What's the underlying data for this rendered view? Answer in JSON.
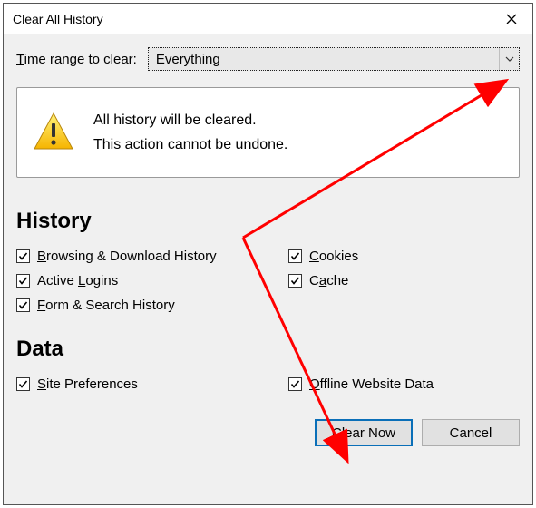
{
  "titlebar": {
    "title": "Clear All History"
  },
  "range": {
    "label_pre": "T",
    "label_ul": "",
    "label": "Time range to clear:",
    "selected": "Everything"
  },
  "warning": {
    "line1": "All history will be cleared.",
    "line2": "This action cannot be undone."
  },
  "sections": {
    "history": "History",
    "data": "Data"
  },
  "checks": {
    "browsing": {
      "label": "Browsing & Download History",
      "ul": "B",
      "checked": true
    },
    "cookies": {
      "label": "Cookies",
      "ul": "C",
      "checked": true
    },
    "logins": {
      "label": "Active Logins",
      "ul": "L",
      "checked": true
    },
    "cache": {
      "label": "Cache",
      "ul": "a",
      "checked": true
    },
    "form": {
      "label": "Form & Search History",
      "ul": "F",
      "checked": true
    },
    "siteprefs": {
      "label": "Site Preferences",
      "ul": "S",
      "checked": true
    },
    "offline": {
      "label": "Offline Website Data",
      "ul": "O",
      "checked": true
    }
  },
  "buttons": {
    "clear_now": "Clear Now",
    "cancel": "Cancel"
  },
  "annotation_color": "#ff0000"
}
